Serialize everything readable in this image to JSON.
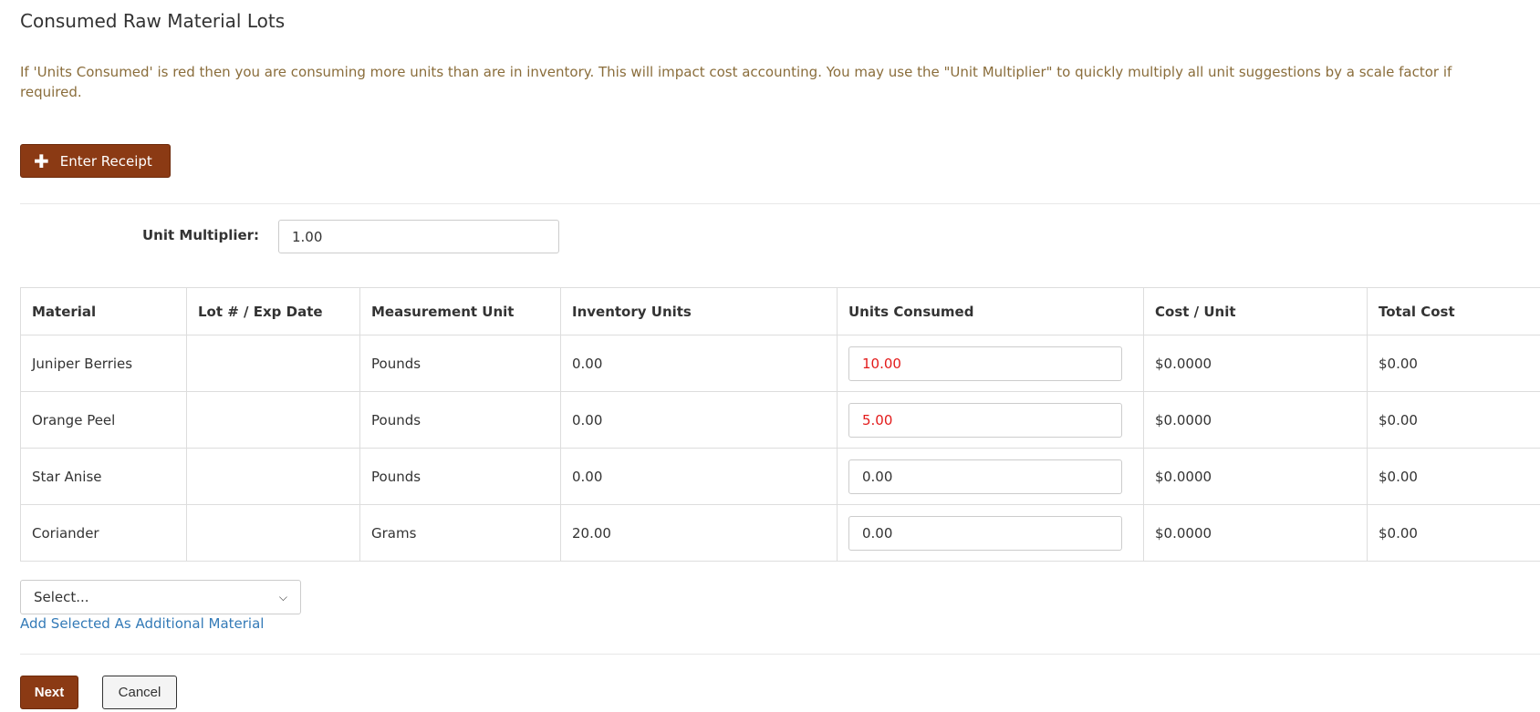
{
  "page": {
    "title": "Consumed Raw Material Lots",
    "info": "If 'Units Consumed' is red then you are consuming more units than are in inventory. This will impact cost accounting. You may use the \"Unit Multiplier\" to quickly multiply all unit suggestions by a scale factor if required."
  },
  "actions": {
    "enter_receipt_label": "Enter Receipt",
    "next_label": "Next",
    "cancel_label": "Cancel",
    "add_material_link": "Add Selected As Additional Material"
  },
  "unit_multiplier": {
    "label": "Unit Multiplier:",
    "value": "1.00"
  },
  "table": {
    "headers": [
      "Material",
      "Lot # / Exp Date",
      "Measurement Unit",
      "Inventory Units",
      "Units Consumed",
      "Cost / Unit",
      "Total Cost"
    ],
    "rows": [
      {
        "material": "Juniper Berries",
        "lot": "",
        "unit": "Pounds",
        "inventory": "0.00",
        "consumed": "10.00",
        "consumed_over": true,
        "cost_unit": "$0.0000",
        "total": "$0.00"
      },
      {
        "material": "Orange Peel",
        "lot": "",
        "unit": "Pounds",
        "inventory": "0.00",
        "consumed": "5.00",
        "consumed_over": true,
        "cost_unit": "$0.0000",
        "total": "$0.00"
      },
      {
        "material": "Star Anise",
        "lot": "",
        "unit": "Pounds",
        "inventory": "0.00",
        "consumed": "0.00",
        "consumed_over": false,
        "cost_unit": "$0.0000",
        "total": "$0.00"
      },
      {
        "material": "Coriander",
        "lot": "",
        "unit": "Grams",
        "inventory": "20.00",
        "consumed": "0.00",
        "consumed_over": false,
        "cost_unit": "$0.0000",
        "total": "$0.00"
      }
    ]
  },
  "material_select": {
    "selected": "Select..."
  },
  "colors": {
    "primary": "#8b3a14",
    "warning_text": "#8a6d3b",
    "over_inventory": "#e31b1b",
    "link": "#337ab7"
  },
  "icons": {
    "plus": "plus-icon",
    "chevron": "chevron-down-icon"
  }
}
